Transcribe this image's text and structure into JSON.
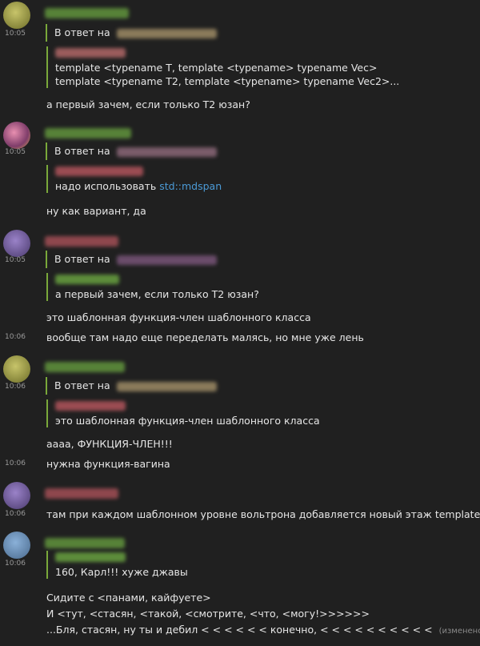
{
  "colors": {
    "background": "#202020",
    "reply_bar": "#7aa83a",
    "link": "#4b9ad6",
    "timestamp": "#9a9a9a"
  },
  "reply_prefix": "В ответ на",
  "messages": [
    {
      "time": "10:05",
      "quote_lines": [
        "template <typename T, template <typename> typename Vec>",
        "template <typename T2, template <typename> typename Vec2>..."
      ],
      "text": "а первый зачем, если только T2 юзан?"
    },
    {
      "time": "10:05",
      "quote_prefix": "надо использовать ",
      "quote_link": "std::mdspan",
      "text": "ну как вариант, да"
    },
    {
      "time": "10:05",
      "quote_text": "а первый зачем, если только T2 юзан?",
      "text": "это шаблонная функция-член шаблонного класса"
    },
    {
      "time": "10:06",
      "text": "вообще там надо еще переделать малясь, но мне уже лень"
    },
    {
      "time": "10:06",
      "quote_text": "это шаблонная функция-член шаблонного класса",
      "text": "аааа, ФУНКЦИЯ-ЧЛЕН!!!"
    },
    {
      "time": "10:06",
      "text": "нужна функция-вагина"
    },
    {
      "time": "10:06",
      "text": "там при каждом шаблонном уровне вольтрона добавляется новый этаж template <>"
    },
    {
      "time": "10:06",
      "quote_text": "160, Карл!!! хуже джавы",
      "lines": [
        "Сидите с <панами, кайфуете>",
        "И <тут, <стасян, <такой, <смотрите, <что, <могу!>>>>>>",
        "...Бля, стасян, ну ты и дебил < < < < < < конечно, < < < < < < < < < <"
      ],
      "edited": "(изменено)"
    }
  ]
}
